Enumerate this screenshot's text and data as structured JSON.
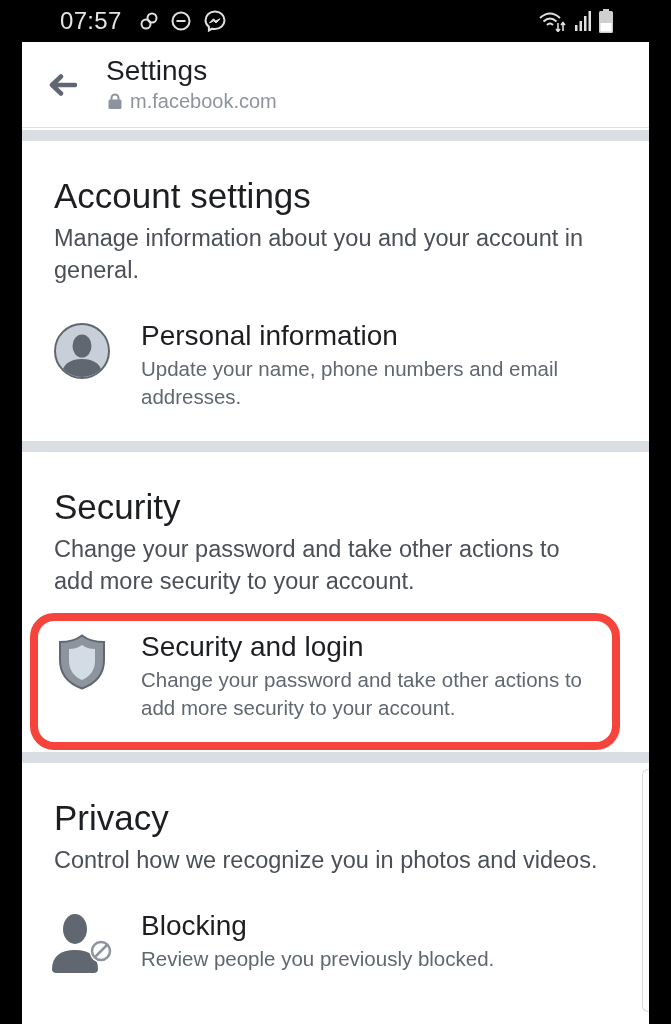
{
  "status_bar": {
    "time": "07:57"
  },
  "header": {
    "title": "Settings",
    "url": "m.facebook.com"
  },
  "sections": [
    {
      "heading": "Account settings",
      "description": "Manage information about you and your account in general.",
      "items": [
        {
          "kind": "profile",
          "title": "Personal information",
          "subtitle": "Update your name, phone numbers and email addresses.",
          "highlighted": false
        }
      ]
    },
    {
      "heading": "Security",
      "description": "Change your password and take other actions to add more security to your account.",
      "items": [
        {
          "kind": "security",
          "title": "Security and login",
          "subtitle": "Change your password and take other actions to add more security to your account.",
          "highlighted": true
        }
      ]
    },
    {
      "heading": "Privacy",
      "description": "Control how we recognize you in photos and videos.",
      "items": [
        {
          "kind": "blocking",
          "title": "Blocking",
          "subtitle": "Review people you previously blocked.",
          "highlighted": false
        }
      ]
    }
  ]
}
